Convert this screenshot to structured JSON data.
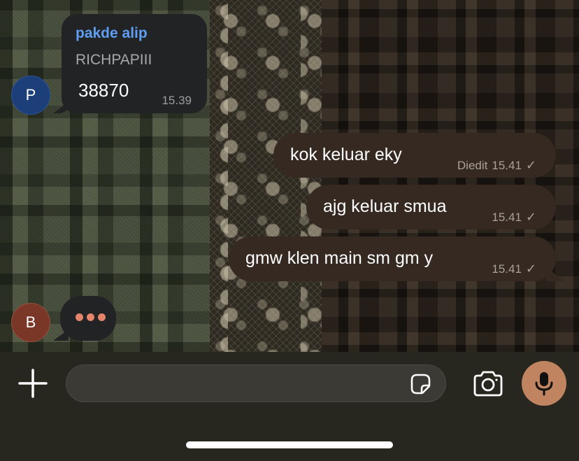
{
  "chat": {
    "incoming": {
      "sender_name": "pakde alip",
      "sender_alias": "RICHPAPIII",
      "text": "38870",
      "time": "15.39",
      "avatar_letter": "P"
    },
    "outgoing": [
      {
        "text": "kok keluar eky",
        "edited_label": "Diedit",
        "time": "15.41"
      },
      {
        "text": "ajg keluar smua",
        "time": "15.41"
      },
      {
        "text": "gmw klen main sm gm y",
        "time": "15.41"
      }
    ],
    "typing": {
      "avatar_letter": "B"
    }
  },
  "composer": {
    "input_value": "",
    "icons": [
      "plus-icon",
      "sticker-icon",
      "camera-icon",
      "microphone-icon"
    ]
  },
  "colors": {
    "sender_name": "#5f9ef1",
    "outgoing_bubble": "#352922",
    "incoming_bubble": "#212325",
    "mic_button": "#c08460",
    "typing_dots": "#e4846a",
    "avatar_p": "#1c3f7a",
    "avatar_b": "#7a3728"
  }
}
